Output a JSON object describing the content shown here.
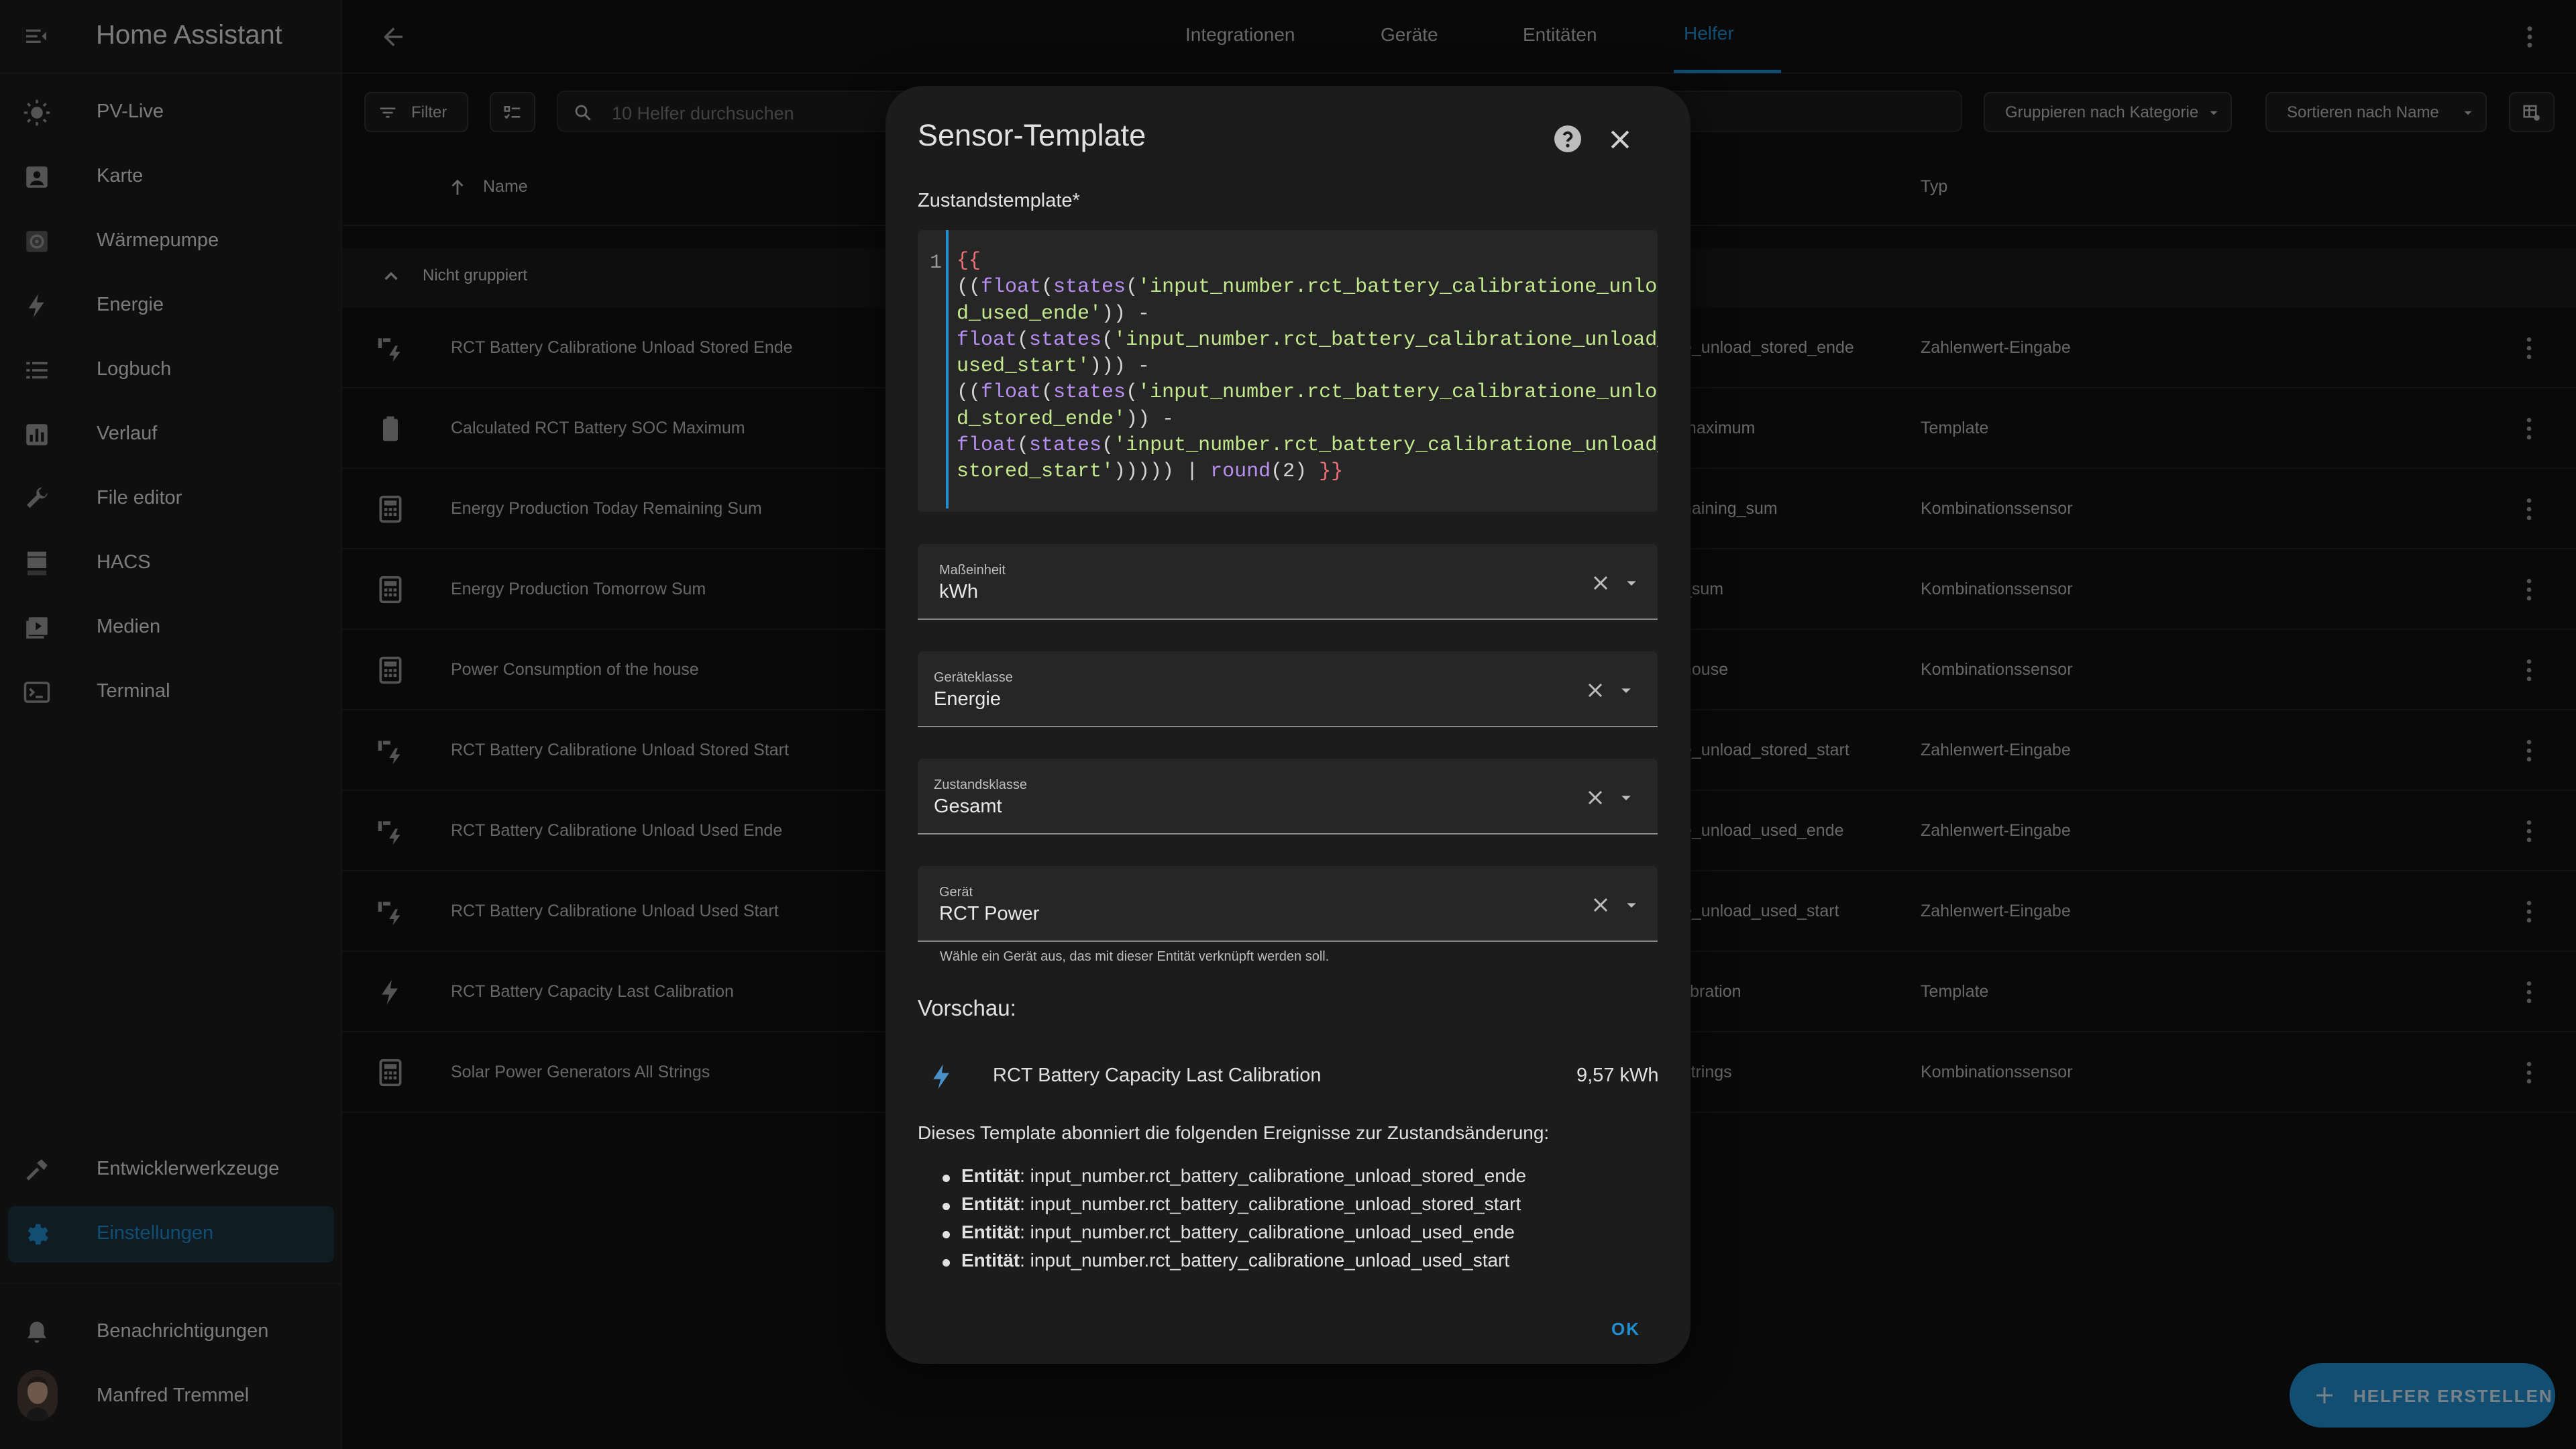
{
  "app": {
    "title": "Home Assistant"
  },
  "sidebar": {
    "items": [
      {
        "label": "PV-Live",
        "icon": "sun-icon"
      },
      {
        "label": "Karte",
        "icon": "map-account-icon"
      },
      {
        "label": "Wärmepumpe",
        "icon": "heatpump-icon"
      },
      {
        "label": "Energie",
        "icon": "lightning-icon"
      },
      {
        "label": "Logbuch",
        "icon": "list-icon"
      },
      {
        "label": "Verlauf",
        "icon": "chart-box-icon"
      },
      {
        "label": "File editor",
        "icon": "wrench-icon"
      },
      {
        "label": "HACS",
        "icon": "hacs-icon"
      },
      {
        "label": "Medien",
        "icon": "play-box-icon"
      },
      {
        "label": "Terminal",
        "icon": "console-icon"
      }
    ],
    "dev_tools": "Entwicklerwerkzeuge",
    "settings": "Einstellungen",
    "notifications": "Benachrichtigungen",
    "user": "Manfred Tremmel",
    "accent": "#1f8fd0"
  },
  "topbar": {
    "tabs": [
      "Integrationen",
      "Geräte",
      "Entitäten",
      "Helfer"
    ],
    "active_tab": "Helfer"
  },
  "toolbar": {
    "filter": "Filter",
    "search_placeholder": "10 Helfer durchsuchen",
    "group_by": "Gruppieren nach Kategorie",
    "sort_by": "Sortieren nach Name"
  },
  "table": {
    "headers": {
      "name": "Name",
      "type": "Typ"
    },
    "group": "Nicht gruppiert",
    "rows": [
      {
        "name": "RCT Battery Calibratione Unload Stored Ende",
        "entity": "e_unload_stored_ende",
        "type": "Zahlenwert-Eingabe",
        "icon": "input-number-icon"
      },
      {
        "name": "Calculated RCT Battery SOC Maximum",
        "entity": "maximum",
        "type": "Template",
        "icon": "battery-icon"
      },
      {
        "name": "Energy Production Today Remaining Sum",
        "entity": "naining_sum",
        "type": "Kombinationssensor",
        "icon": "calculator-icon"
      },
      {
        "name": "Energy Production Tomorrow Sum",
        "entity": "_sum",
        "type": "Kombinationssensor",
        "icon": "calculator-icon"
      },
      {
        "name": "Power Consumption of the house",
        "entity": "house",
        "type": "Kombinationssensor",
        "icon": "calculator-icon"
      },
      {
        "name": "RCT Battery Calibratione Unload Stored Start",
        "entity": "e_unload_stored_start",
        "type": "Zahlenwert-Eingabe",
        "icon": "input-number-icon"
      },
      {
        "name": "RCT Battery Calibratione Unload Used Ende",
        "entity": "e_unload_used_ende",
        "type": "Zahlenwert-Eingabe",
        "icon": "input-number-icon"
      },
      {
        "name": "RCT Battery Calibratione Unload Used Start",
        "entity": "e_unload_used_start",
        "type": "Zahlenwert-Eingabe",
        "icon": "input-number-icon"
      },
      {
        "name": "RCT Battery Capacity Last Calibration",
        "entity": "libration",
        "type": "Template",
        "icon": "lightning-icon"
      },
      {
        "name": "Solar Power Generators All Strings",
        "entity": "strings",
        "type": "Kombinationssensor",
        "icon": "calculator-icon"
      }
    ]
  },
  "fab": {
    "label": "HELFER ERSTELLEN"
  },
  "dialog": {
    "title": "Sensor-Template",
    "template_label": "Zustandstemplate*",
    "code_line_number": "1",
    "fields": {
      "unit": {
        "label": "Maßeinheit",
        "value": "kWh"
      },
      "device_class": {
        "label": "Geräteklasse",
        "value": "Energie"
      },
      "state_class": {
        "label": "Zustandsklasse",
        "value": "Gesamt"
      },
      "device": {
        "label": "Gerät",
        "value": "RCT Power",
        "hint": "Wähle ein Gerät aus, das mit dieser Entität verknüpft werden soll."
      }
    },
    "preview": {
      "title": "Vorschau:",
      "name": "RCT Battery Capacity Last Calibration",
      "value": "9,57 kWh"
    },
    "description": "Dieses Template abonniert die folgenden Ereignisse zur Zustandsänderung:",
    "entity_label": "Entität",
    "entities": [
      "input_number.rct_battery_calibratione_unload_stored_ende",
      "input_number.rct_battery_calibratione_unload_stored_start",
      "input_number.rct_battery_calibratione_unload_used_ende",
      "input_number.rct_battery_calibratione_unload_used_start"
    ],
    "ok": "OK"
  }
}
